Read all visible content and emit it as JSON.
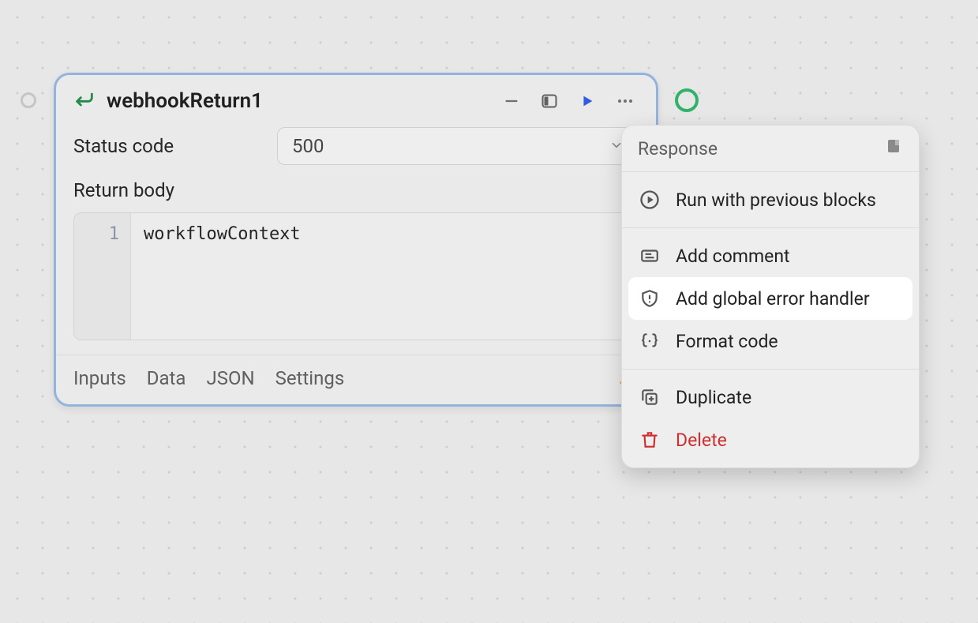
{
  "node": {
    "title": "webhookReturn1",
    "fields": {
      "status_code_label": "Status code",
      "status_code_value": "500",
      "return_body_label": "Return body"
    },
    "code": {
      "line_number": "1",
      "content": "workflowContext"
    },
    "tabs": {
      "inputs": "Inputs",
      "data": "Data",
      "json": "JSON",
      "settings": "Settings"
    }
  },
  "menu": {
    "header": "Response",
    "items": {
      "run_prev": "Run with previous blocks",
      "add_comment": "Add comment",
      "add_error_handler": "Add global error handler",
      "format_code": "Format code",
      "duplicate": "Duplicate",
      "delete": "Delete"
    }
  }
}
